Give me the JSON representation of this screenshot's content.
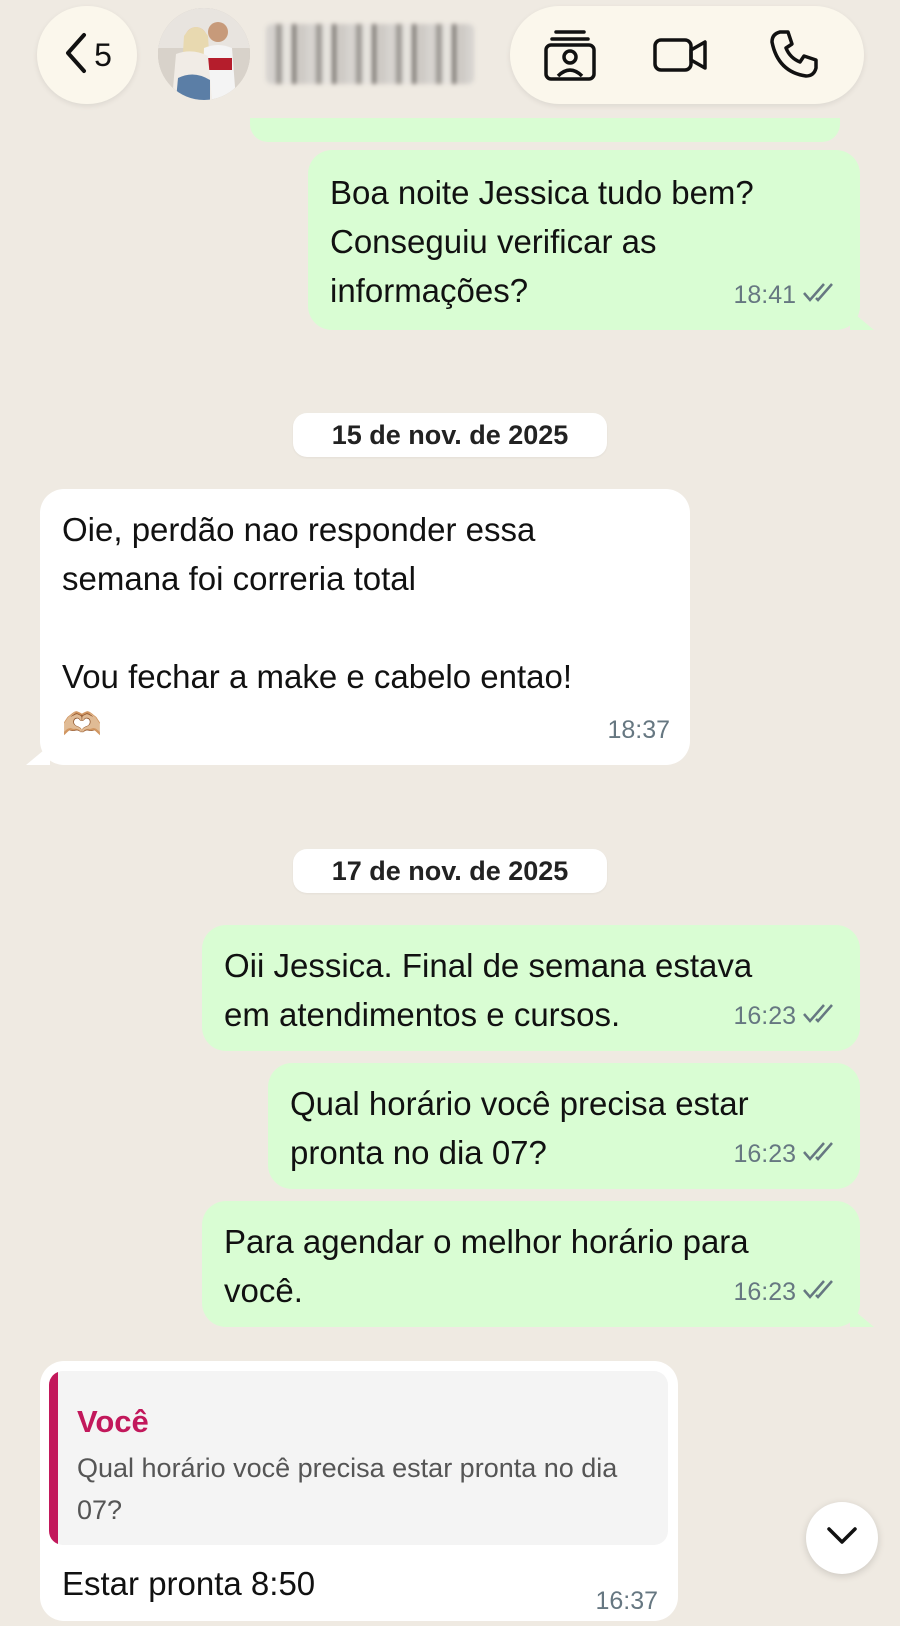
{
  "header": {
    "unread_count": "5",
    "icons": {
      "back": "chevron-left-icon",
      "contact_card": "contact-card-icon",
      "video": "video-camera-icon",
      "phone": "phone-icon"
    }
  },
  "messages": [
    {
      "type": "outgoing",
      "text": "Boa noite Jessica tudo bem?\nConseguiu verificar as\ninformações?",
      "time": "18:41",
      "status": "read"
    },
    {
      "type": "date",
      "label": "15 de nov. de 2025"
    },
    {
      "type": "incoming",
      "text": "Oie, perdão nao responder essa\nsemana foi correria total\n\nVou fechar a make e cabelo entao!",
      "emoji": "🫶🏼",
      "time": "18:37"
    },
    {
      "type": "date",
      "label": "17 de nov. de 2025"
    },
    {
      "type": "outgoing",
      "text": "Oii Jessica. Final de semana estava\nem atendimentos e cursos.",
      "time": "16:23",
      "status": "read"
    },
    {
      "type": "outgoing",
      "text": "Qual horário você precisa estar\npronta no dia 07?",
      "time": "16:23",
      "status": "read"
    },
    {
      "type": "outgoing",
      "text": "Para agendar o melhor horário para\nvocê.",
      "time": "16:23",
      "status": "read"
    },
    {
      "type": "incoming_reply",
      "quote_author": "Você",
      "quote_text": "Qual horário você precisa estar pronta no dia 07?",
      "text": "Estar pronta 8:50",
      "time": "16:37"
    }
  ],
  "colors": {
    "chat_background": "#efeae2",
    "outgoing_bubble": "#d9fdd3",
    "incoming_bubble": "#ffffff",
    "quote_accent": "#c2185b",
    "read_ticks": "#667781"
  },
  "scroll_button_icon": "chevron-down-icon"
}
